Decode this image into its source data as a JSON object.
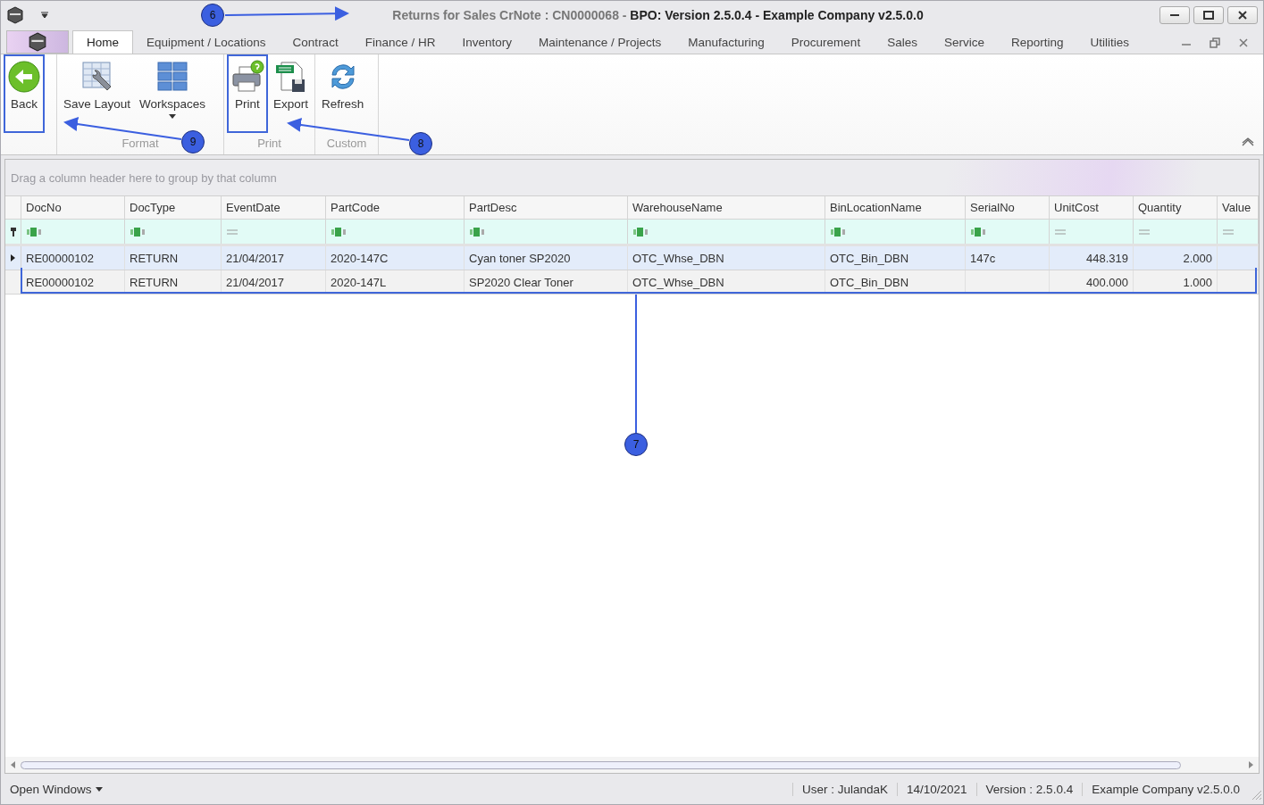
{
  "window": {
    "context": "Returns for Sales CrNote : CN0000068 - ",
    "app": "BPO: Version 2.5.0.4 - Example Company v2.5.0.0"
  },
  "ribbon_tabs": [
    {
      "label": "Home",
      "selected": true
    },
    {
      "label": "Equipment / Locations",
      "selected": false
    },
    {
      "label": "Contract",
      "selected": false
    },
    {
      "label": "Finance / HR",
      "selected": false
    },
    {
      "label": "Inventory",
      "selected": false
    },
    {
      "label": "Maintenance / Projects",
      "selected": false
    },
    {
      "label": "Manufacturing",
      "selected": false
    },
    {
      "label": "Procurement",
      "selected": false
    },
    {
      "label": "Sales",
      "selected": false
    },
    {
      "label": "Service",
      "selected": false
    },
    {
      "label": "Reporting",
      "selected": false
    },
    {
      "label": "Utilities",
      "selected": false
    }
  ],
  "ribbon_groups": [
    {
      "buttons": [
        {
          "label": "Back",
          "kind": "back",
          "highlighted": true
        }
      ]
    },
    {
      "label": "Format",
      "buttons": [
        {
          "label": "Save Layout",
          "kind": "save-layout",
          "highlighted": false
        },
        {
          "label": "Workspaces",
          "kind": "workspaces",
          "highlighted": false,
          "dropdown": true
        }
      ]
    },
    {
      "label": "Print",
      "buttons": [
        {
          "label": "Print",
          "kind": "print",
          "highlighted": true
        },
        {
          "label": "Export",
          "kind": "export",
          "highlighted": false
        }
      ]
    },
    {
      "label": "Custom",
      "buttons": [
        {
          "label": "Refresh",
          "kind": "refresh",
          "highlighted": false
        }
      ]
    }
  ],
  "grid": {
    "group_panel_hint": "Drag a column header here to group by that column",
    "columns": [
      {
        "label": "DocNo",
        "kind": "text"
      },
      {
        "label": "DocType",
        "kind": "text"
      },
      {
        "label": "EventDate",
        "kind": "date"
      },
      {
        "label": "PartCode",
        "kind": "text"
      },
      {
        "label": "PartDesc",
        "kind": "text"
      },
      {
        "label": "WarehouseName",
        "kind": "text"
      },
      {
        "label": "BinLocationName",
        "kind": "text"
      },
      {
        "label": "SerialNo",
        "kind": "text"
      },
      {
        "label": "UnitCost",
        "kind": "number"
      },
      {
        "label": "Quantity",
        "kind": "number"
      },
      {
        "label": "Value",
        "kind": "number"
      }
    ],
    "rows": [
      {
        "selected": true,
        "cells": [
          "RE00000102",
          "RETURN",
          "21/04/2017",
          "2020-147C",
          "Cyan toner SP2020",
          "OTC_Whse_DBN",
          "OTC_Bin_DBN",
          "147c",
          "448.319",
          "2.000",
          ""
        ]
      },
      {
        "selected": false,
        "cells": [
          "RE00000102",
          "RETURN",
          "21/04/2017",
          "2020-147L",
          "SP2020 Clear Toner",
          "OTC_Whse_DBN",
          "OTC_Bin_DBN",
          "",
          "400.000",
          "1.000",
          ""
        ]
      }
    ]
  },
  "status_bar": {
    "menu": "Open Windows",
    "items": [
      "User : JulandaK",
      "14/10/2021",
      "Version : 2.5.0.4",
      "Example Company v2.5.0.0"
    ]
  },
  "callouts": [
    {
      "number": "6",
      "kind": "title"
    },
    {
      "number": "9",
      "kind": "back"
    },
    {
      "number": "8",
      "kind": "print"
    },
    {
      "number": "7",
      "kind": "rows"
    }
  ]
}
